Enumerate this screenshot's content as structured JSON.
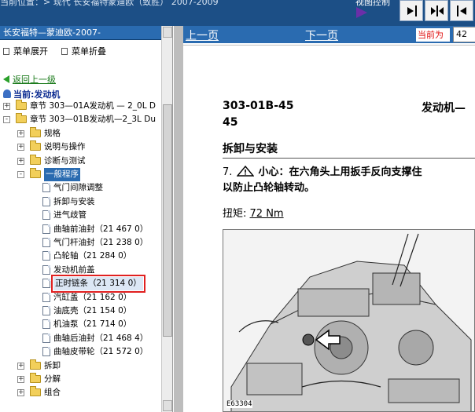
{
  "topbar": {
    "crumb": "当前位置：> 现代 长安福特蒙迪欧（致胜） 2007-2009",
    "view_control": "视图控制",
    "buttons": [
      "prev-panel-button",
      "split-button",
      "next-panel-button"
    ]
  },
  "sidebar": {
    "title": "长安福特—蒙迪欧-2007-",
    "expand_label": "菜单展开",
    "collapse_label": "菜单折叠",
    "back_label": "返回上一级",
    "current_label": "当前:发动机",
    "tree": [
      {
        "level": 0,
        "toggle": "+",
        "icon": "folder",
        "label": "章节 303—01A发动机 — 2_0L D"
      },
      {
        "level": 0,
        "toggle": "-",
        "icon": "folder",
        "label": "章节 303—01B发动机—2_3L Du"
      },
      {
        "level": 1,
        "toggle": "+",
        "icon": "folder",
        "label": "规格"
      },
      {
        "level": 1,
        "toggle": "+",
        "icon": "folder",
        "label": "说明与操作"
      },
      {
        "level": 1,
        "toggle": "+",
        "icon": "folder",
        "label": "诊断与测试"
      },
      {
        "level": 1,
        "toggle": "-",
        "icon": "folder",
        "label": "一般程序",
        "selected": true
      },
      {
        "level": 2,
        "icon": "page",
        "label": "气门间隙调整"
      },
      {
        "level": 2,
        "icon": "page",
        "label": "拆卸与安装"
      },
      {
        "level": 2,
        "icon": "page",
        "label": "进气歧管"
      },
      {
        "level": 2,
        "icon": "page",
        "label": "曲轴前油封（21 467 0）"
      },
      {
        "level": 2,
        "icon": "page",
        "label": "气门杆油封（21 238 0）"
      },
      {
        "level": 2,
        "icon": "page",
        "label": "凸轮轴（21 284 0）"
      },
      {
        "level": 2,
        "icon": "page",
        "label": "发动机前盖"
      },
      {
        "level": 2,
        "icon": "page",
        "label": "正时链条（21 314 0）",
        "highlighted": true
      },
      {
        "level": 2,
        "icon": "page",
        "label": "汽缸盖（21 162 0）"
      },
      {
        "level": 2,
        "icon": "page",
        "label": "油底壳（21 154 0）"
      },
      {
        "level": 2,
        "icon": "page",
        "label": "机油泵（21 714 0）"
      },
      {
        "level": 2,
        "icon": "page",
        "label": "曲轴后油封（21 468 4）"
      },
      {
        "level": 2,
        "icon": "page",
        "label": "曲轴皮带轮（21 572 0）"
      },
      {
        "level": 1,
        "toggle": "+",
        "icon": "folder",
        "label": "拆卸"
      },
      {
        "level": 1,
        "toggle": "+",
        "icon": "folder",
        "label": "分解"
      },
      {
        "level": 1,
        "toggle": "+",
        "icon": "folder",
        "label": "组合"
      }
    ]
  },
  "nav": {
    "prev": "上一页",
    "next": "下一页",
    "current_label": "当前为",
    "page_value": "42"
  },
  "document": {
    "code": "303-01B-45",
    "page_num": "45",
    "title_right": "发动机—",
    "section": "拆卸与安装",
    "step_number": "7.",
    "caution_label": "小心：",
    "caution_text_1": "在六角头上用扳手反向支撑住",
    "caution_text_2": "以防止凸轮轴转动。",
    "torque_label": "扭矩:",
    "torque_value": "72 Nm",
    "figure_id": "E63304"
  },
  "colors": {
    "title_bar": "#2a6bb0",
    "top_banner": "#1c4f86",
    "highlight_box": "#e02020",
    "current_label_text": "#e01010"
  }
}
